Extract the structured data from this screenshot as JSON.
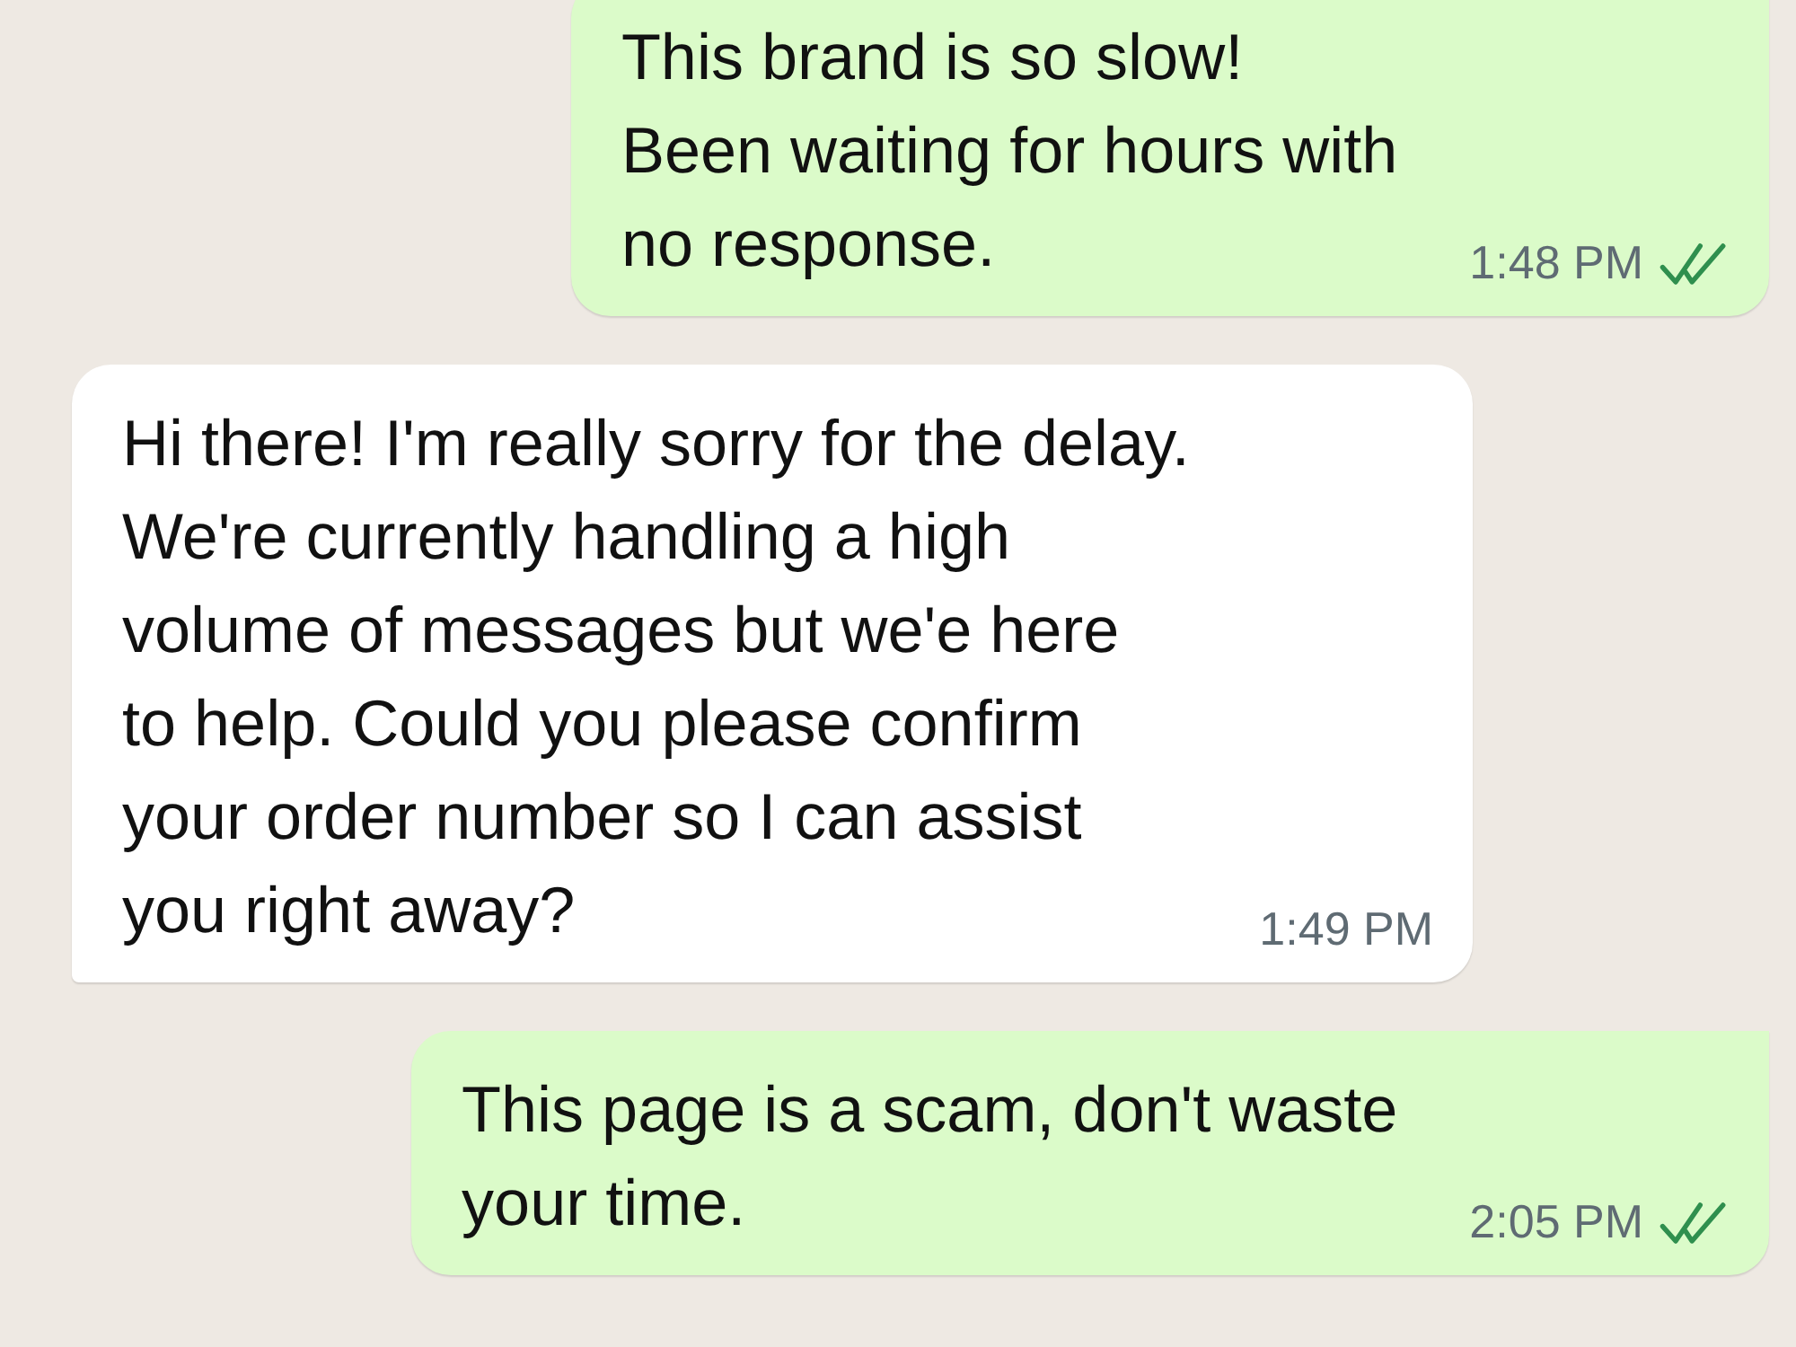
{
  "messages": [
    {
      "kind": "outgoing",
      "text": "This brand is so slow!\nBeen waiting for hours with\nno response.",
      "time": "1:48 PM",
      "read": true
    },
    {
      "kind": "incoming",
      "text": "Hi there! I'm really sorry for the delay.\nWe're currently handling a high\nvolume of messages but we'e here\nto help. Could you please confirm\nyour order number so I can assist\nyou right away?",
      "time": "1:49 PM"
    },
    {
      "kind": "outgoing",
      "text": "This page is a scam, don't waste\nyour time.",
      "time": "2:05 PM",
      "read": true
    }
  ]
}
